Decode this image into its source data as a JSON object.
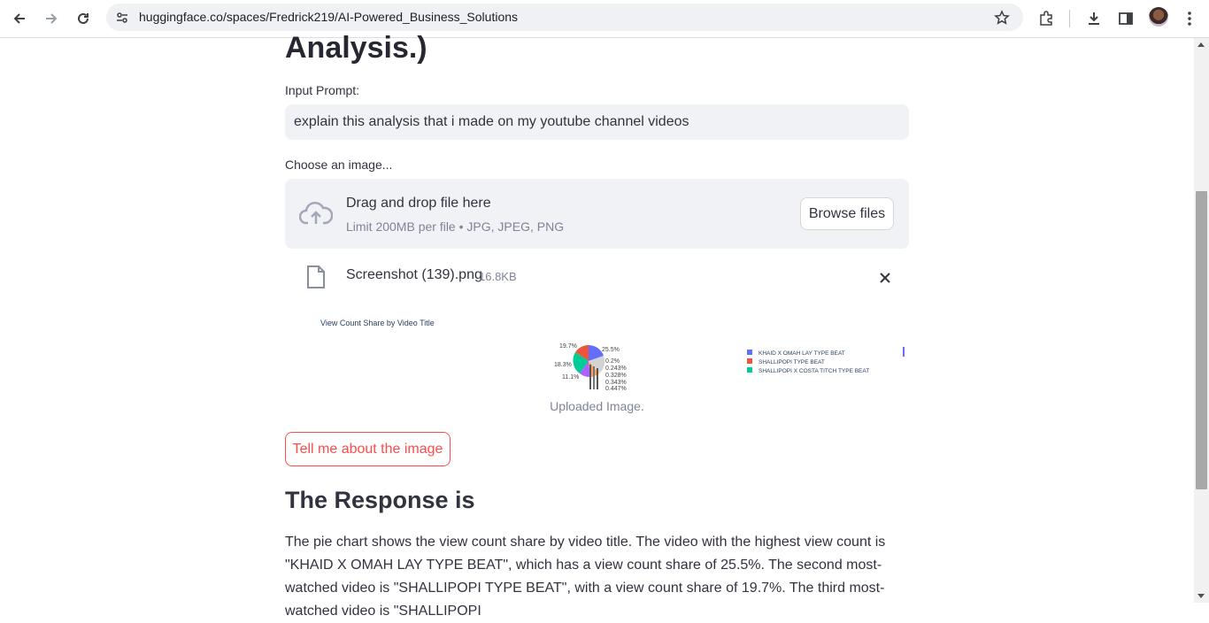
{
  "browser": {
    "url": "huggingface.co/spaces/Fredrick219/AI-Powered_Business_Solutions"
  },
  "page": {
    "heading_tail": "Analysis.)",
    "input_label": "Input Prompt:",
    "input_value": "explain this analysis that i made on my youtube channel videos",
    "image_label": "Choose an image...",
    "dropzone_title": "Drag and drop file here",
    "dropzone_limit": "Limit 200MB per file • JPG, JPEG, PNG",
    "browse_label": "Browse files",
    "file_name": "Screenshot (139).png",
    "file_size": "16.8KB",
    "caption": "Uploaded Image.",
    "tell_button": "Tell me about the image",
    "response_heading": "The Response is",
    "response_text": "The pie chart shows the view count share by video title. The video with the highest view count is \"KHAID X OMAH LAY TYPE BEAT\", which has a view count share of 25.5%. The second most-watched video is \"SHALLIPOPI TYPE BEAT\", with a view count share of 19.7%. The third most-watched video is \"SHALLIPOPI"
  },
  "thumbnail": {
    "title": "View Count Share by Video Title",
    "slice_labels": [
      "19.7%",
      "25.5%",
      "18.3%",
      "0.2%",
      "0.243%",
      "11.1%",
      "0.328%",
      "0.343%",
      "0.447%"
    ],
    "legend": [
      "KHAID X OMAH LAY TYPE BEAT",
      "SHALLIPOPI TYPE BEAT",
      "SHALLIPOPI X COSTA TITCH TYPE BEAT"
    ],
    "colors": [
      "#636efa",
      "#ef553b",
      "#00cc96"
    ]
  }
}
